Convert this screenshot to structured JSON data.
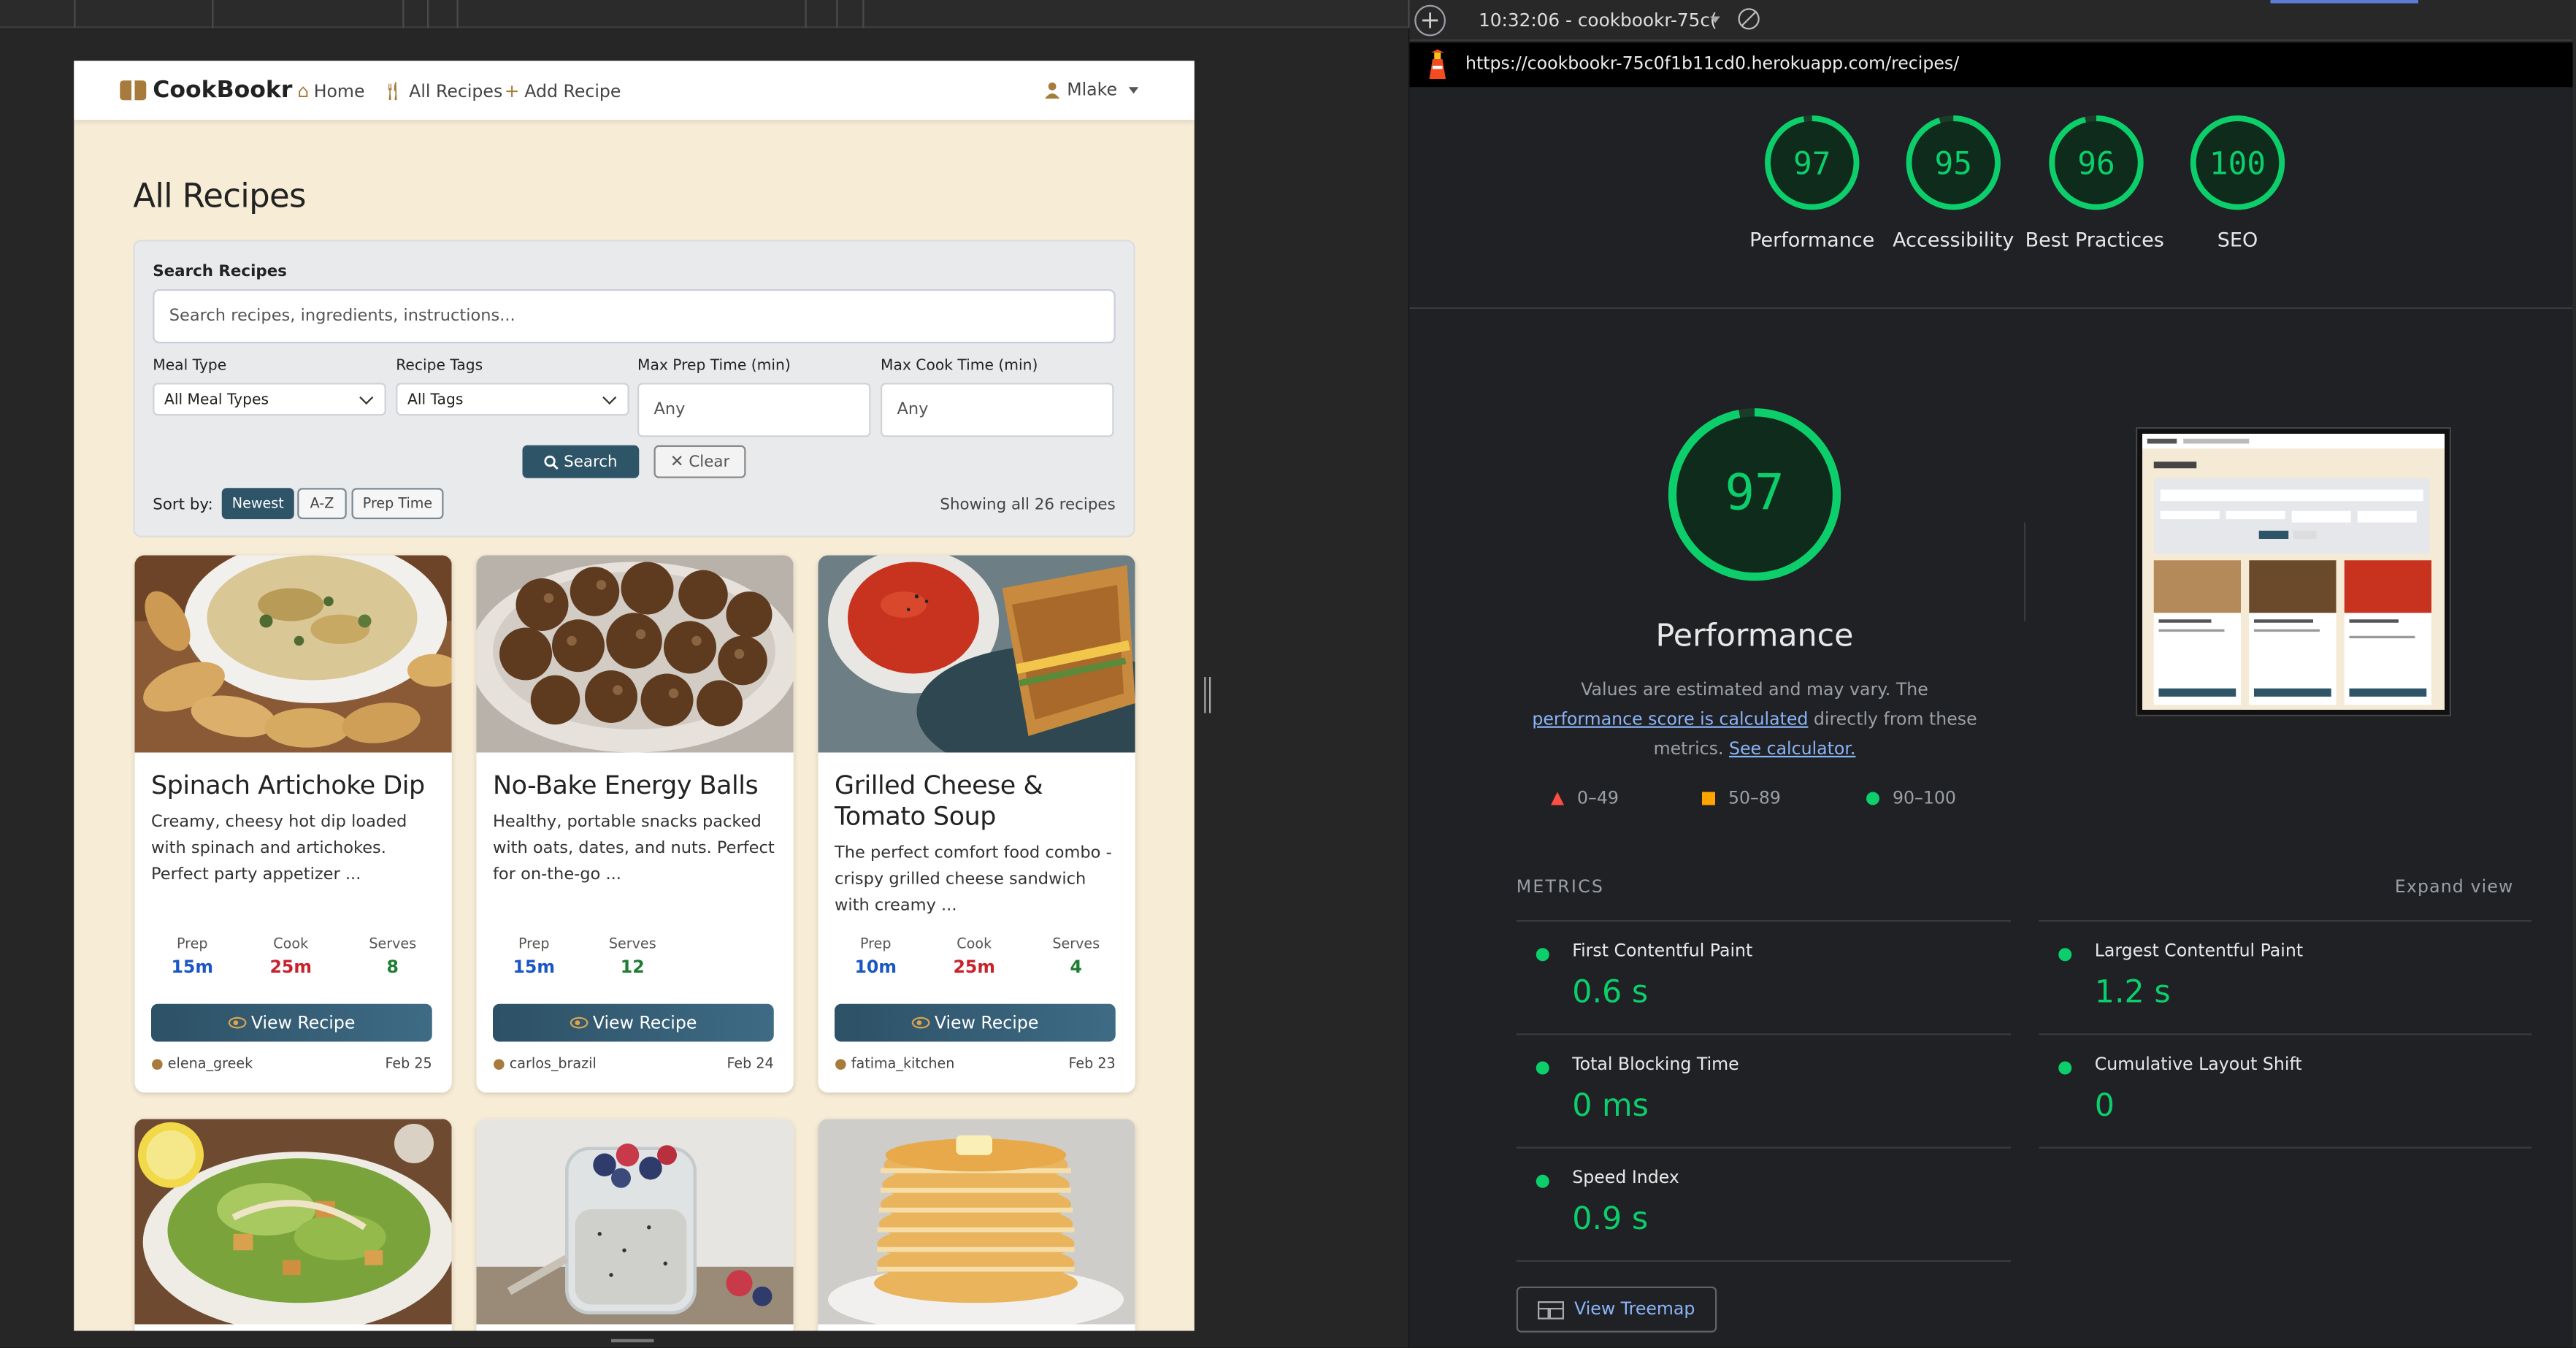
{
  "nav": {
    "brand": "CookBookr",
    "home": "Home",
    "all_recipes": "All Recipes",
    "add_recipe": "Add Recipe",
    "user": "Mlake"
  },
  "page_title": "All Recipes",
  "search": {
    "label": "Search Recipes",
    "placeholder": "Search recipes, ingredients, instructions...",
    "meal_type_label": "Meal Type",
    "meal_type_value": "All Meal Types",
    "tags_label": "Recipe Tags",
    "tags_value": "All Tags",
    "prep_label": "Max Prep Time (min)",
    "prep_placeholder": "Any",
    "cook_label": "Max Cook Time (min)",
    "cook_placeholder": "Any",
    "search_btn": "Search",
    "clear_btn": "Clear",
    "sort_label": "Sort by:",
    "sort_newest": "Newest",
    "sort_az": "A-Z",
    "sort_prep": "Prep Time",
    "showing": "Showing all 26 recipes"
  },
  "recipes": [
    {
      "title": "Spinach Artichoke Dip",
      "desc": "Creamy, cheesy hot dip loaded with spinach and artichokes. Perfect party appetizer ...",
      "stats": [
        {
          "k": "Prep",
          "v": "15m",
          "color": "#1a56c4"
        },
        {
          "k": "Cook",
          "v": "25m",
          "color": "#c8232c"
        },
        {
          "k": "Serves",
          "v": "8",
          "color": "#1e7d32"
        }
      ],
      "button": "View Recipe",
      "author": "elena_greek",
      "date": "Feb 25"
    },
    {
      "title": "No-Bake Energy Balls",
      "desc": "Healthy, portable snacks packed with oats, dates, and nuts. Perfect for on-the-go ...",
      "stats": [
        {
          "k": "Prep",
          "v": "15m",
          "color": "#1a56c4"
        },
        {
          "k": "Serves",
          "v": "12",
          "color": "#1e7d32"
        }
      ],
      "button": "View Recipe",
      "author": "carlos_brazil",
      "date": "Feb 24"
    },
    {
      "title": "Grilled Cheese & Tomato Soup",
      "desc": "The perfect comfort food combo - crispy grilled cheese sandwich with creamy ...",
      "stats": [
        {
          "k": "Prep",
          "v": "10m",
          "color": "#1a56c4"
        },
        {
          "k": "Cook",
          "v": "25m",
          "color": "#c8232c"
        },
        {
          "k": "Serves",
          "v": "4",
          "color": "#1e7d32"
        }
      ],
      "button": "View Recipe",
      "author": "fatima_kitchen",
      "date": "Feb 23"
    }
  ],
  "devtools": {
    "time_title": "10:32:06 - cookbookr-75c(",
    "url": "https://cookbookr-75c0f1b11cd0.herokuapp.com/recipes/",
    "scores": [
      {
        "label": "Performance",
        "value": "97",
        "fraction": 0.97
      },
      {
        "label": "Accessibility",
        "value": "95",
        "fraction": 0.95
      },
      {
        "label": "Best Practices",
        "value": "96",
        "fraction": 0.96
      },
      {
        "label": "SEO",
        "value": "100",
        "fraction": 1.0
      }
    ],
    "big_score": "97",
    "big_title": "Performance",
    "note_pre": "Values are estimated and may vary. The ",
    "note_link1": "performance score is calculated",
    "note_mid": " directly from these metrics. ",
    "note_link2": "See calculator.",
    "legend": [
      "0–49",
      "50–89",
      "90–100"
    ],
    "metrics_heading": "METRICS",
    "expand": "Expand view",
    "metrics": [
      {
        "name": "First Contentful Paint",
        "value": "0.6 s"
      },
      {
        "name": "Largest Contentful Paint",
        "value": "1.2 s"
      },
      {
        "name": "Total Blocking Time",
        "value": "0 ms"
      },
      {
        "name": "Cumulative Layout Shift",
        "value": "0"
      },
      {
        "name": "Speed Index",
        "value": "0.9 s"
      }
    ],
    "treemap": "View Treemap",
    "colors": {
      "pass": "#0cce6b",
      "average": "#ffa400",
      "fail": "#ff4e42"
    }
  }
}
